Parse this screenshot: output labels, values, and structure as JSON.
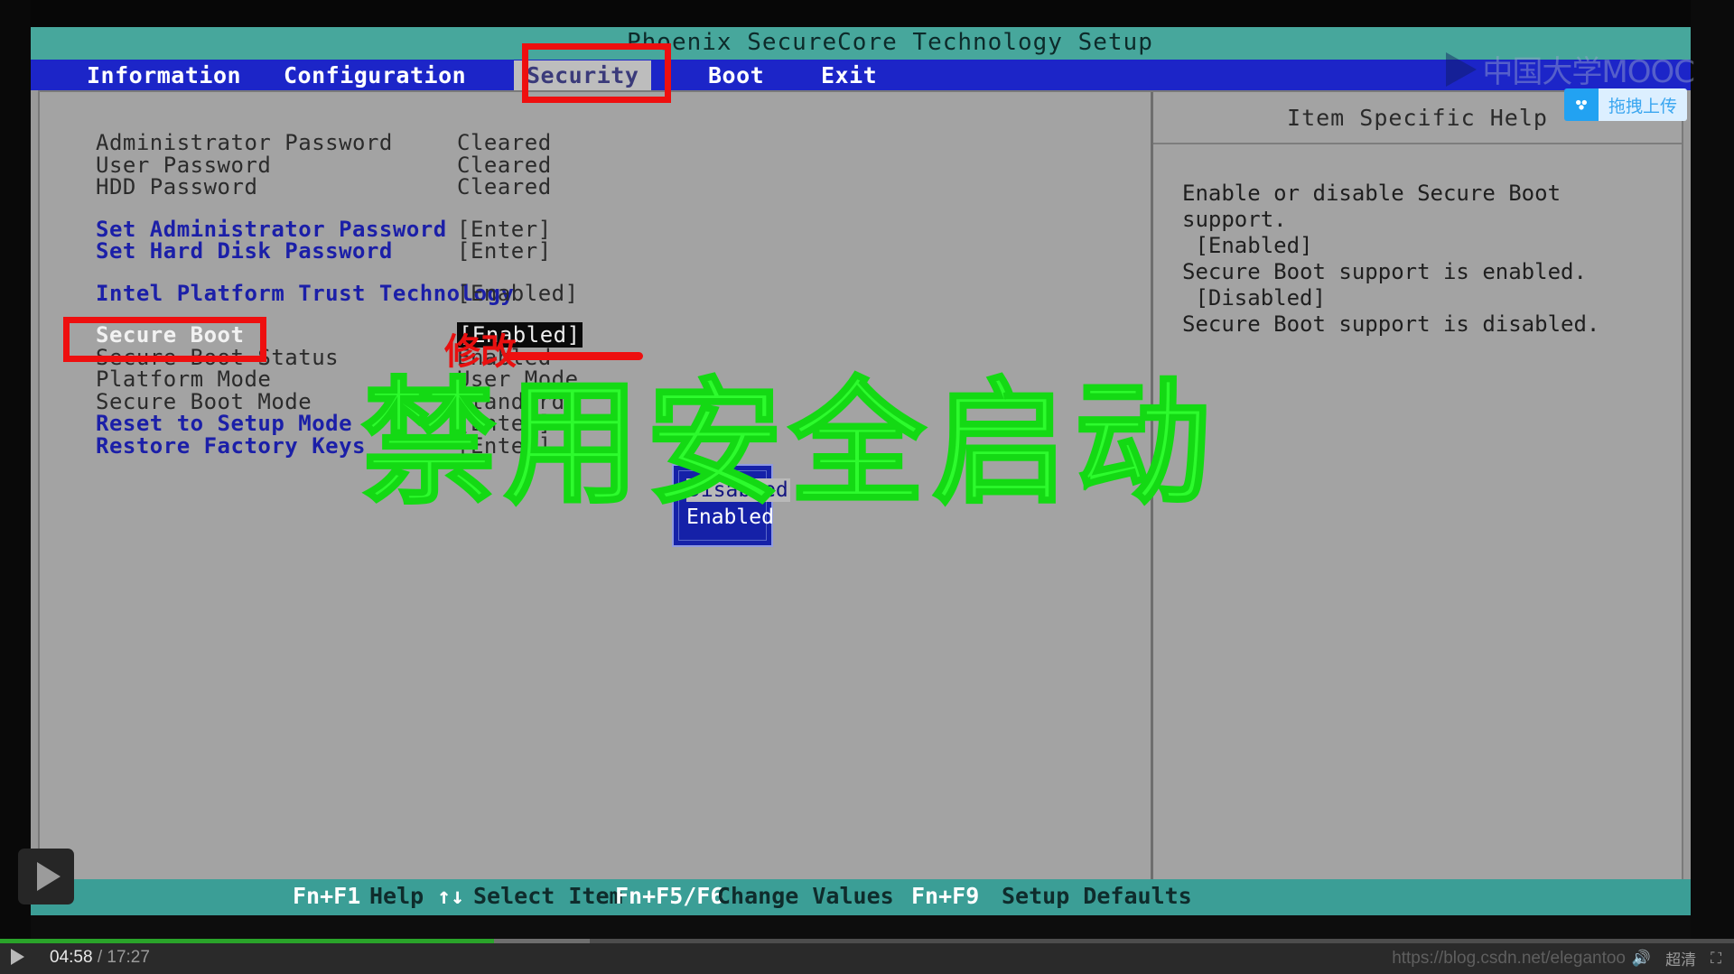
{
  "bios": {
    "title": "Phoenix SecureCore Technology Setup",
    "menu": [
      {
        "label": "Information"
      },
      {
        "label": "Configuration"
      },
      {
        "label": "Security"
      },
      {
        "label": "Boot"
      },
      {
        "label": "Exit"
      }
    ],
    "selected_tab": "Security",
    "rows": [
      {
        "label": "Administrator Password",
        "value": "Cleared",
        "style": "dark"
      },
      {
        "label": "User Password",
        "value": "Cleared",
        "style": "dark"
      },
      {
        "label": "HDD Password",
        "value": "Cleared",
        "style": "dark"
      },
      {
        "label": "Set Administrator Password",
        "value": "[Enter]",
        "style": "blue"
      },
      {
        "label": "Set Hard Disk Password",
        "value": "[Enter]",
        "style": "blue"
      },
      {
        "label": "Intel Platform Trust Technology",
        "value": "[Enabled]",
        "style": "blue"
      },
      {
        "label": "Secure Boot",
        "value": "[Enabled]",
        "style": "selected"
      },
      {
        "label": "Secure Boot Status",
        "value": "Enabled",
        "style": "dark"
      },
      {
        "label": "Platform Mode",
        "value": "User Mode",
        "style": "dark"
      },
      {
        "label": "Secure Boot Mode",
        "value": "Standard",
        "style": "dark"
      },
      {
        "label": "Reset to Setup Mode",
        "value": "[Enter]",
        "style": "blue"
      },
      {
        "label": "Restore Factory Keys",
        "value": "[Enter]",
        "style": "blue"
      }
    ],
    "popup": {
      "options": [
        "Disabled",
        "Enabled"
      ],
      "highlighted": "Disabled"
    },
    "help": {
      "title": "Item Specific Help",
      "body": "Enable or disable Secure Boot\nsupport.\n [Enabled]\nSecure Boot support is enabled.\n [Disabled]\nSecure Boot support is disabled."
    },
    "footer": [
      {
        "key": "Fn+F1",
        "action": "Help"
      },
      {
        "key": "↑↓",
        "action": "Select Item"
      },
      {
        "key": "Fn+F5/F6",
        "action": "Change Values"
      },
      {
        "key": "Fn+F9",
        "action": "Setup Defaults"
      }
    ]
  },
  "annotations": {
    "modify_label": "修改",
    "big_overlay": "禁用安全启动",
    "red_color": "#ee0f0f",
    "green_color": "#2dfb2d"
  },
  "overlay": {
    "logo_text": "中国大学MOOC",
    "upload_chip": "拖拽上传",
    "upload_icon": "cloud-upload-icon",
    "play_icon": "play-icon"
  },
  "player": {
    "current_time": "04:58",
    "separator": "/",
    "total_time": "17:27",
    "play_icon": "play-icon",
    "watermark": "https://blog.csdn.net/elegantoo",
    "volume_icon": "volume-icon",
    "quality_label": "超清",
    "fullscreen_icon": "fullscreen-icon",
    "progress_percent": 28.5
  }
}
